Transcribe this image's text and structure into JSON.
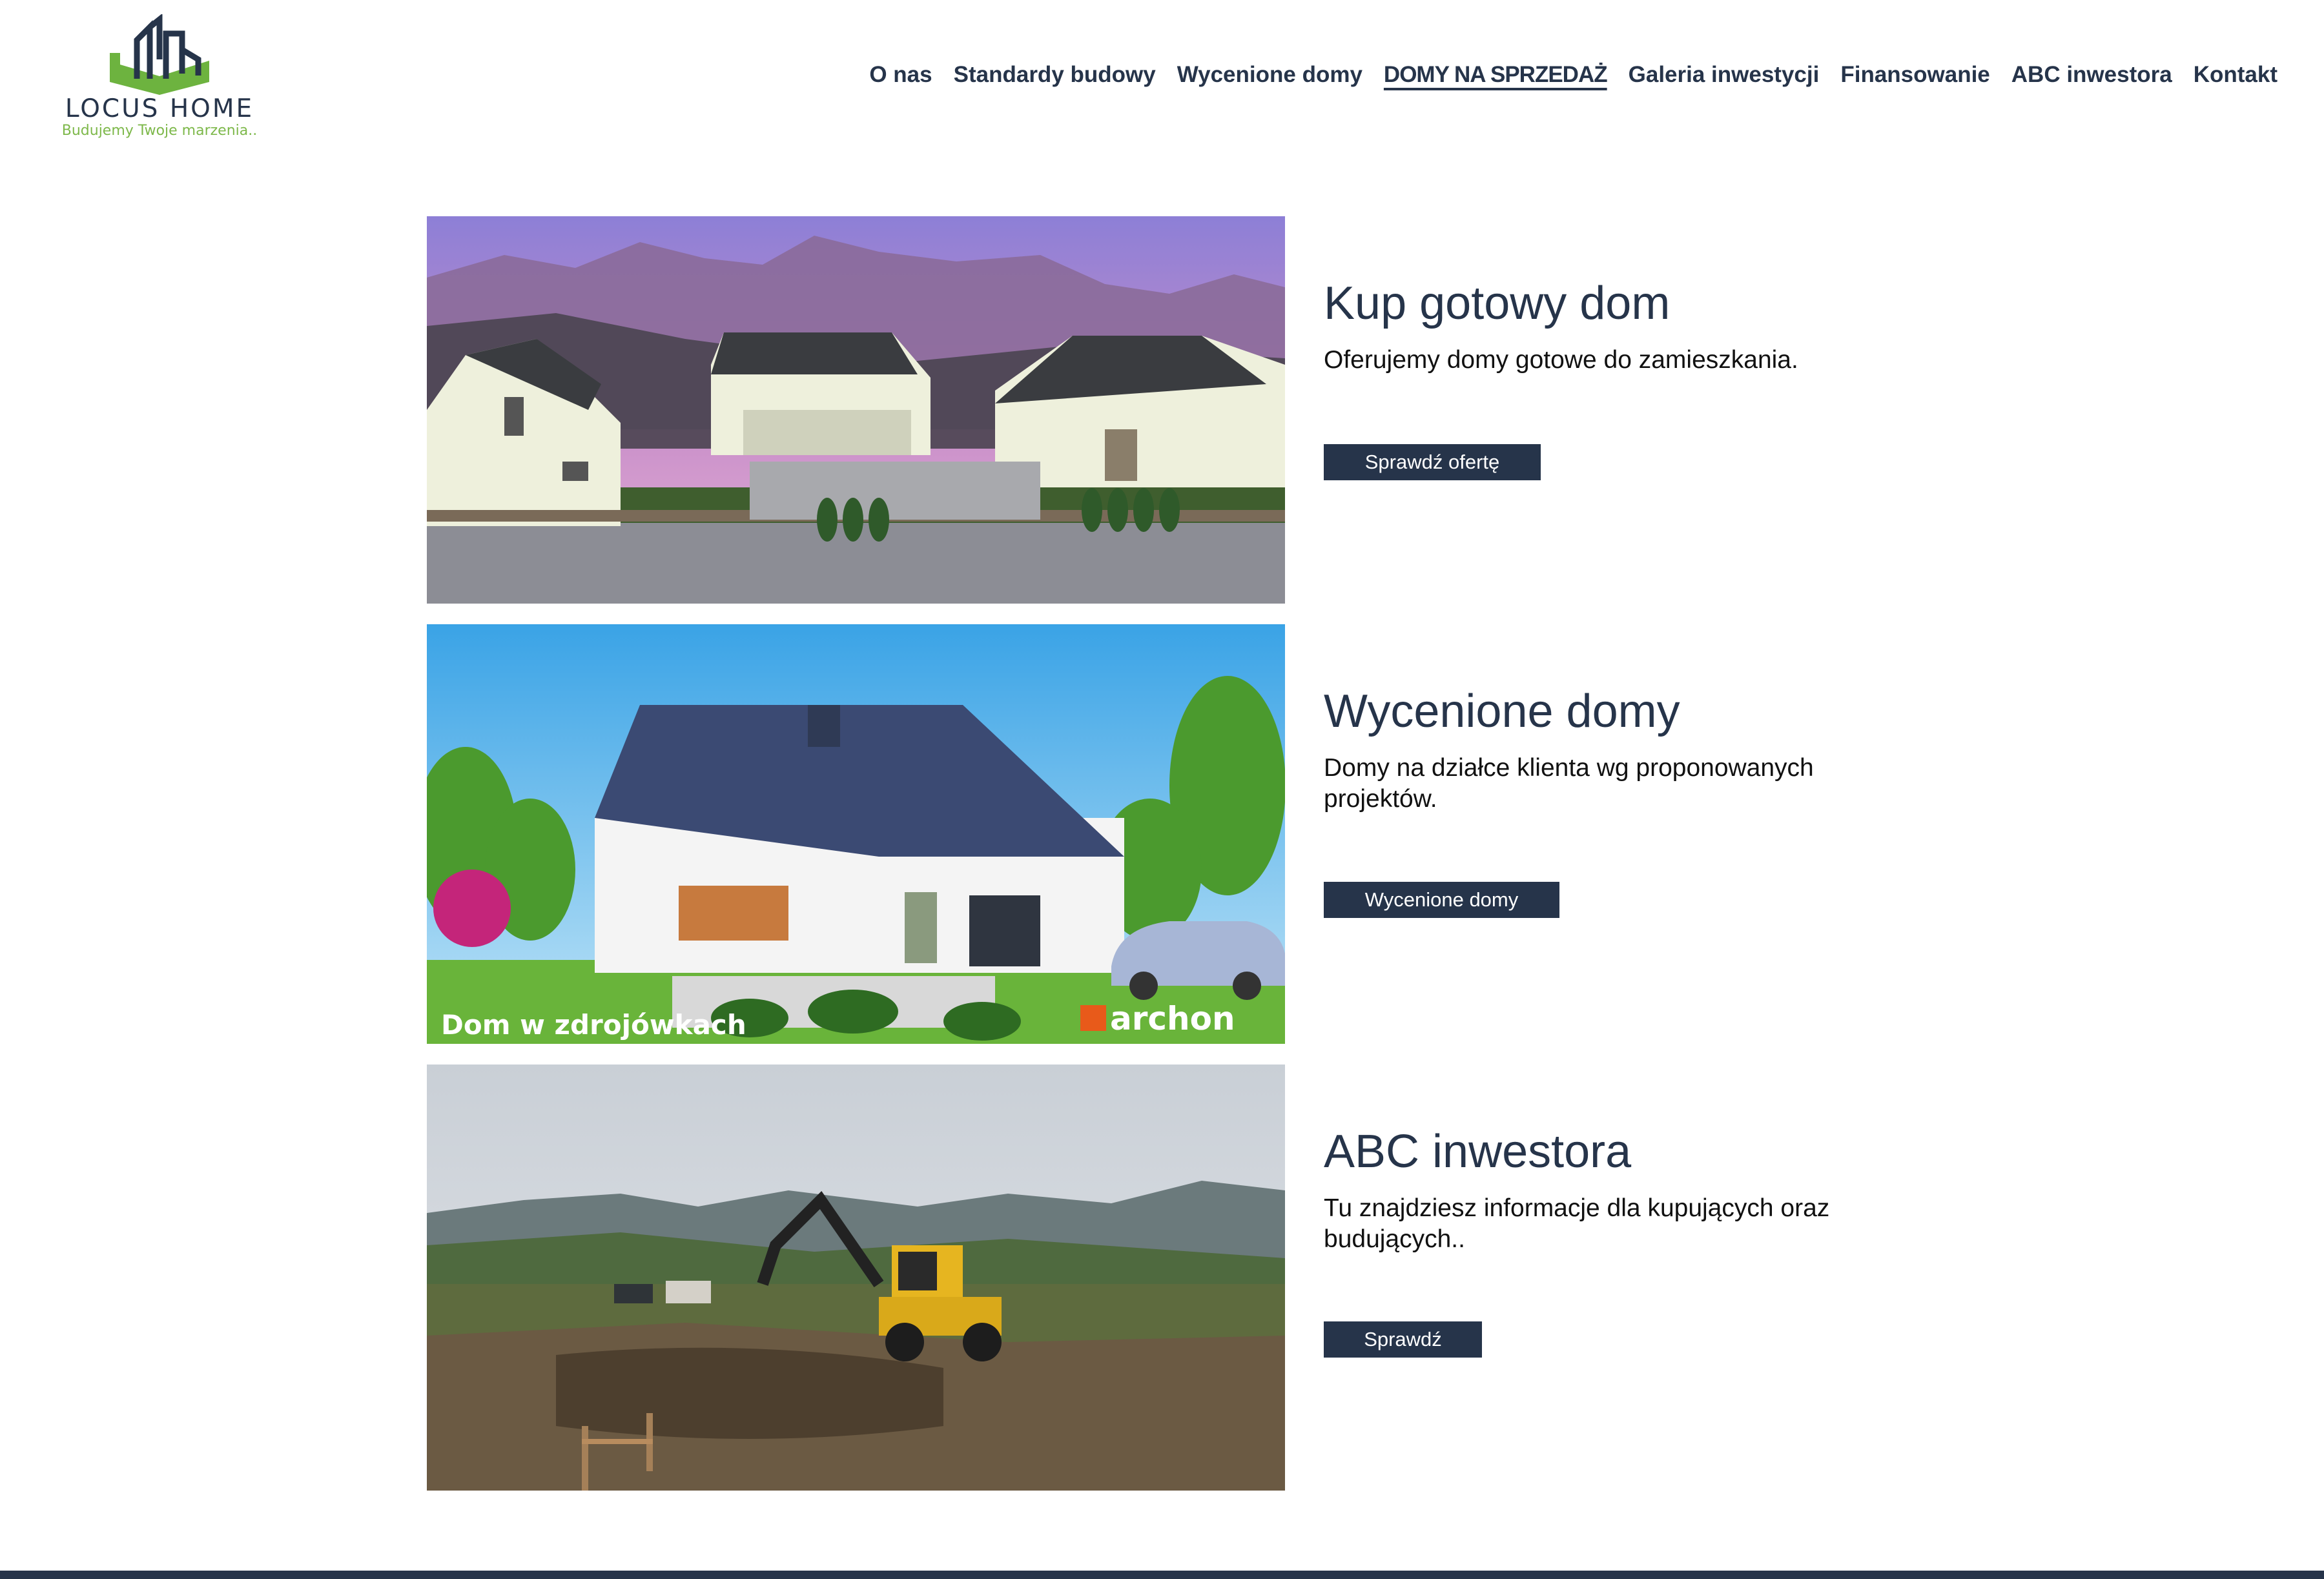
{
  "brand": {
    "name": "LOCUS HOME",
    "tagline": "Budujemy Twoje marzenia.."
  },
  "nav": {
    "items": [
      {
        "label": "O nas"
      },
      {
        "label": "Standardy budowy"
      },
      {
        "label": "Wycenione domy"
      },
      {
        "label": "DOMY NA SPRZEDAŻ",
        "active": true
      },
      {
        "label": "Galeria inwestycji"
      },
      {
        "label": "Finansowanie"
      },
      {
        "label": "ABC inwestora"
      },
      {
        "label": "Kontakt"
      }
    ]
  },
  "sections": [
    {
      "title": "Kup gotowy dom",
      "description": "Oferujemy domy gotowe do zamieszkania.",
      "button": "Sprawdź ofertę",
      "image": "rendered-houses-mountains"
    },
    {
      "title": "Wycenione domy",
      "description": "Domy na działce klienta wg proponowanych projektów.",
      "button": "Wycenione domy",
      "image": "house-render-archon",
      "image_caption": "Dom w zdrojówkach",
      "image_brand": "archon"
    },
    {
      "title": "ABC inwestora",
      "description": "Tu znajdziesz informacje dla kupujących oraz budujących..",
      "button": "Sprawdź",
      "image": "excavator-construction-site"
    }
  ],
  "colors": {
    "primary": "#26344a",
    "accent_green": "#7db84a",
    "background": "#ffffff"
  }
}
